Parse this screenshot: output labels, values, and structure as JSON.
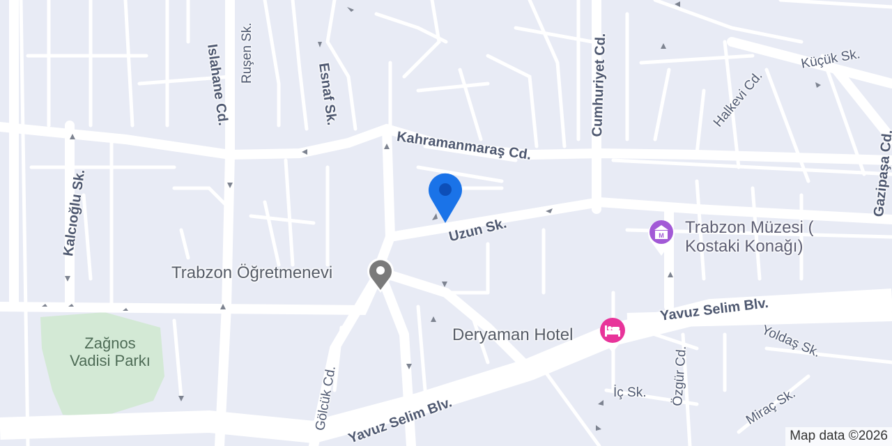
{
  "map": {
    "colors": {
      "land": "#e8ebf5",
      "road": "#ffffff",
      "park": "#d3e9d5",
      "pin_blue": "#1a73e8",
      "pin_gray": "#7a7a7a",
      "museum": "#a259d6",
      "hotel": "#e8349a"
    },
    "streets": {
      "rusen": "Ruşen Sk.",
      "islahane": "Islahane Cd.",
      "esnaf": "Esnaf Sk.",
      "cumhuriyet": "Cumhuriyet Cd.",
      "kucuk": "Küçük Sk.",
      "halkevi": "Halkevi Cd.",
      "gazipasa": "Gazipaşa Cd.",
      "kahramanmaras": "Kahramanmaraş Cd.",
      "kalcioglu": "Kalcıoğlu Sk.",
      "uzun": "Uzun Sk.",
      "yavuz_selim_1": "Yavuz Selim Blv.",
      "yavuz_selim_2": "Yavuz Selim Blv.",
      "yoldas": "Yoldaş Sk.",
      "gol_cuk": "Gölcük Cd.",
      "ozgur": "Özgür Cd.",
      "ic": "İç Sk.",
      "mirac": "Miraç Sk."
    },
    "places": {
      "ogretmenevi": "Trabzon Öğretmenevi",
      "museum_line1": "Trabzon Müzesi (",
      "museum_line2": "Kostaki Konağı)",
      "hotel": "Deryaman Hotel",
      "park_line1": "Zağnos",
      "park_line2": "Vadisi Parkı"
    },
    "icons": {
      "selected": "location-pin-icon",
      "ogretmenevi": "place-pin-icon",
      "museum": "museum-icon",
      "hotel": "hotel-bed-icon"
    },
    "attribution": "Map data ©2026"
  }
}
